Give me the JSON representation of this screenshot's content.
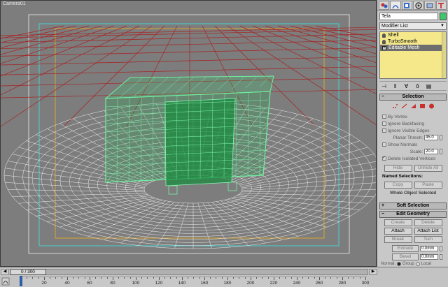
{
  "viewport": {
    "label": "Camera01"
  },
  "panel": {
    "tabs": [
      "create-icon",
      "modify-icon",
      "hierarchy-icon",
      "motion-icon",
      "display-icon",
      "utilities-icon"
    ],
    "object_name": "Tela",
    "object_color": "#3fc86a",
    "modifier_list_label": "Modifier List",
    "stack": [
      {
        "label": "Shell",
        "selected": false
      },
      {
        "label": "TurboSmooth",
        "selected": false
      },
      {
        "label": "Editable Mesh",
        "selected": true
      }
    ],
    "selection": {
      "title": "Selection",
      "by_vertex": "By Vertex",
      "ignore_backfacing": "Ignore Backfacing",
      "ignore_visible_edges": "Ignore Visible Edges",
      "planar_thresh_label": "Planar Thresh:",
      "planar_thresh_value": "45.0",
      "show_normals": "Show Normals",
      "scale_label": "Scale:",
      "scale_value": "20.0",
      "delete_isolated": "Delete Isolated Vertices",
      "hide": "Hide",
      "unhide_all": "Unhide All",
      "named_selections": "Named Selections:",
      "copy": "Copy",
      "paste": "Paste",
      "status": "Whole Object Selected"
    },
    "soft_selection": {
      "title": "Soft Selection"
    },
    "edit_geometry": {
      "title": "Edit Geometry",
      "create": "Create",
      "delete": "Delete",
      "attach": "Attach",
      "attach_list": "Attach List",
      "break": "Break",
      "turn": "Turn",
      "extrude_label": "Extrude",
      "extrude_value": "0.0mm",
      "bevel_label": "Bevel",
      "bevel_value": "0.0mm",
      "normal_label": "Normal:",
      "group_label": "Group",
      "local_label": "Local"
    }
  },
  "timeline": {
    "frame_display": "0 / 300",
    "ticks": [
      "0",
      "20",
      "40",
      "60",
      "80",
      "100",
      "120",
      "140",
      "160",
      "180",
      "200",
      "220",
      "240",
      "260",
      "280",
      "300"
    ]
  }
}
